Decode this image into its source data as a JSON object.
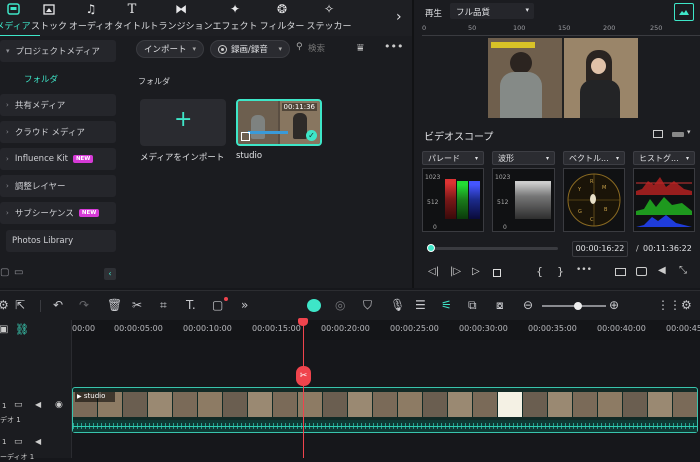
{
  "toolbar": {
    "tabs": [
      {
        "label": "メディア",
        "icon": "media-icon",
        "active": true
      },
      {
        "label": "ストック",
        "icon": "stock-icon"
      },
      {
        "label": "オーディオ",
        "icon": "music-note-icon"
      },
      {
        "label": "タイトル",
        "icon": "title-t-icon"
      },
      {
        "label": "トランジション",
        "icon": "transition-icon"
      },
      {
        "label": "エフェクト",
        "icon": "effects-icon"
      },
      {
        "label": "フィルター",
        "icon": "filter-icon"
      },
      {
        "label": "ステッカー",
        "icon": "sticker-icon"
      }
    ],
    "more_glyph": "›"
  },
  "sidebar": {
    "items": [
      {
        "label": "プロジェクトメディア",
        "caret": "▾"
      },
      {
        "label": "フォルダ"
      },
      {
        "label": "共有メディア",
        "caret": "›"
      },
      {
        "label": "クラウド メディア",
        "caret": "›"
      },
      {
        "label": "Influence Kit",
        "caret": "›",
        "badge": "NEW"
      },
      {
        "label": "調整レイヤー",
        "caret": "›"
      },
      {
        "label": "サブシーケンス",
        "caret": "›",
        "badge": "NEW"
      },
      {
        "label": "Photos Library"
      }
    ]
  },
  "media": {
    "import_label": "インポート",
    "record_label": "録画/録音",
    "search_placeholder": "検索",
    "folder_title": "フォルダ",
    "import_card_label": "メディアをインポート",
    "clip_name": "studio",
    "clip_duration": "00:11:36"
  },
  "player": {
    "play_label": "再生",
    "quality": "フル品質",
    "ruler": [
      "0",
      "50",
      "100",
      "150",
      "200",
      "250"
    ]
  },
  "scope": {
    "title": "ビデオスコープ",
    "modes": [
      "パレード",
      "波形",
      "ベクトル...",
      "ヒストグ..."
    ],
    "parade_ticks": [
      "1023",
      "512",
      "0"
    ],
    "wave_ticks": [
      "1023",
      "512",
      "0"
    ],
    "current_time": "00:00:16:22",
    "total_time": "00:11:36:22",
    "separator": "/",
    "progress": 0.02
  },
  "timeline": {
    "marks": [
      "00:00",
      "00:00:05:00",
      "00:00:10:00",
      "00:00:15:00",
      "00:00:20:00",
      "00:00:25:00",
      "00:00:30:00",
      "00:00:35:00",
      "00:00:40:00",
      "00:00:45"
    ],
    "video_track": "デオ 1",
    "audio_track": "ーディオ 1",
    "track_num_v": "1",
    "track_num_a": "1",
    "clip_label": "studio"
  },
  "colors": {
    "accent": "#3ee6c8",
    "playhead": "#f0444d",
    "badge": "#d63ad7"
  }
}
